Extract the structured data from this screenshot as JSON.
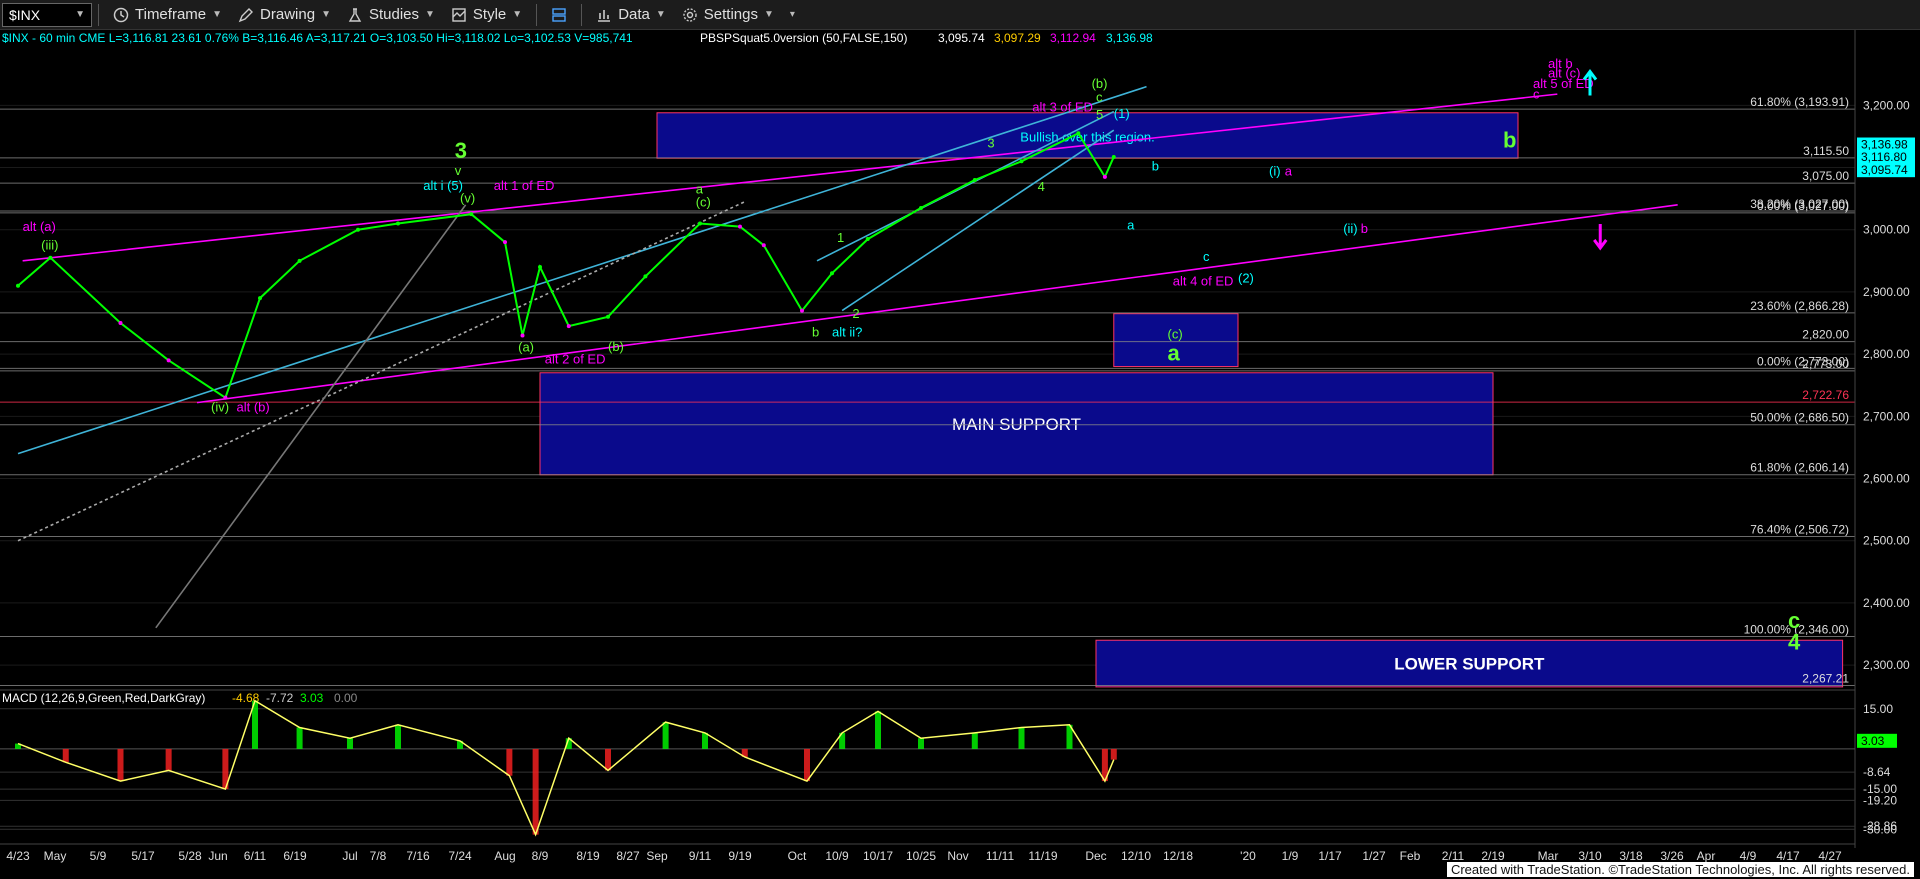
{
  "toolbar": {
    "symbol": "$INX",
    "timeframe": "Timeframe",
    "drawing": "Drawing",
    "studies": "Studies",
    "style": "Style",
    "data": "Data",
    "settings": "Settings"
  },
  "colors": {
    "price_up": "#00ff00",
    "price_down": "#ff00ff",
    "magenta": "#ff00ff",
    "cyan": "#00ffff",
    "green_label": "#66ff33",
    "box_fill": "#0a0a8c"
  },
  "chart_data": {
    "type": "line",
    "title": "$INX - 60 min  CME  L=3,116.81  23.61  0.76%  B=3,116.46  A=3,117.21  O=3,103.50  Hi=3,118.02  Lo=3,102.53  V=985,741",
    "indicator_header": "PBSPSquat5.0version (50,FALSE,150)",
    "indicator_values": [
      "3,095.74",
      "3,097.29",
      "3,112.94",
      "3,136.98"
    ],
    "ylim": [
      2260,
      3260
    ],
    "y_ticks": [
      3200,
      3100,
      3000,
      2900,
      2800,
      2700,
      2600,
      2500,
      2400,
      2300
    ],
    "y_tick_labels": [
      "3,200.00",
      "3,100.00",
      "3,000.00",
      "2,900.00",
      "2,800.00",
      "2,700.00",
      "2,600.00",
      "2,500.00",
      "2,400.00",
      "2,300.00"
    ],
    "x_labels": [
      "4/23",
      "May",
      "5/9",
      "5/17",
      "5/28",
      "Jun",
      "6/11",
      "6/19",
      "Jul",
      "7/8",
      "7/16",
      "7/24",
      "Aug",
      "8/9",
      "8/19",
      "8/27",
      "Sep",
      "9/11",
      "9/19",
      "Oct",
      "10/9",
      "10/17",
      "10/25",
      "Nov",
      "11/11",
      "11/19",
      "Dec",
      "12/10",
      "12/18",
      "'20",
      "1/9",
      "1/17",
      "1/27",
      "Feb",
      "2/11",
      "2/19",
      "Mar",
      "3/10",
      "3/18",
      "3/26",
      "Apr",
      "4/9",
      "4/17",
      "4/27"
    ],
    "price_series": {
      "name": "",
      "x": [
        "4/23",
        "4/30",
        "5/13",
        "5/23",
        "6/3",
        "6/12",
        "6/20",
        "7/3",
        "7/12",
        "7/26",
        "8/1",
        "8/5",
        "8/9",
        "8/15",
        "8/23",
        "8/30",
        "9/11",
        "9/19",
        "9/24",
        "10/2",
        "10/8",
        "10/15",
        "10/25",
        "11/5",
        "11/15",
        "11/27",
        "12/3",
        "12/5"
      ],
      "y": [
        2910,
        2955,
        2850,
        2790,
        2730,
        2890,
        2950,
        3000,
        3010,
        3025,
        2980,
        2830,
        2940,
        2845,
        2860,
        2925,
        3010,
        3005,
        2975,
        2870,
        2930,
        2985,
        3035,
        3080,
        3110,
        3155,
        3085,
        3117
      ]
    },
    "price_labels": [
      {
        "value": "3,136.98",
        "color": "#00ffff"
      },
      {
        "value": "3,116.80",
        "color": "#00ffff"
      },
      {
        "value": "3,095.74",
        "color": "#00ffff"
      }
    ],
    "fib_levels": [
      {
        "label": "61.80% (3,193.91)",
        "value": 3193.91
      },
      {
        "label": "3,115.50",
        "value": 3115.5
      },
      {
        "label": "3,075.00",
        "value": 3075.0
      },
      {
        "label": "38.20% (3,027.00)",
        "value": 3030.0
      },
      {
        "label": "0.00% (3,027.00)",
        "value": 3027.0
      },
      {
        "label": "23.60% (2,866.28)",
        "value": 2866.28
      },
      {
        "label": "2,820.00",
        "value": 2820.0
      },
      {
        "label": "0.00% (2,773.00)",
        "value": 2777.0
      },
      {
        "label": "2,773.00",
        "value": 2773.0
      },
      {
        "label": "2,722.76",
        "value": 2722.76
      },
      {
        "label": "50.00% (2,686.50)",
        "value": 2686.5
      },
      {
        "label": "61.80% (2,606.14)",
        "value": 2606.14
      },
      {
        "label": "76.40% (2,506.72)",
        "value": 2506.72
      },
      {
        "label": "100.00% (2,346.00)",
        "value": 2346.0
      },
      {
        "label": "2,267.21",
        "value": 2267.21
      }
    ],
    "zones": [
      {
        "label": "Bullish over this region.",
        "y1": 3115,
        "y2": 3188,
        "x1": "9/1",
        "x2": "2/24"
      },
      {
        "label": "MAIN SUPPORT",
        "y1": 2606,
        "y2": 2770,
        "x1": "8/9",
        "x2": "2/19"
      },
      {
        "label": "LOWER SUPPORT",
        "y1": 2265,
        "y2": 2340,
        "x1": "12/1",
        "x2": "4/30"
      },
      {
        "label": "",
        "y1": 2780,
        "y2": 2865,
        "x1": "12/5",
        "x2": "12/30"
      }
    ],
    "wave_labels": [
      {
        "text": "alt (a)",
        "x": "4/24",
        "y": 2998,
        "color": "#ff00ff"
      },
      {
        "text": "(iii)",
        "x": "4/28",
        "y": 2968,
        "color": "#66ff33"
      },
      {
        "text": "(iv)",
        "x": "5/31",
        "y": 2708,
        "color": "#66ff33"
      },
      {
        "text": "alt (b)",
        "x": "6/6",
        "y": 2708,
        "color": "#ff00ff"
      },
      {
        "text": "3",
        "x": "7/23",
        "y": 3115,
        "color": "#66ff33"
      },
      {
        "text": "v",
        "x": "7/23",
        "y": 3088,
        "color": "#66ff33"
      },
      {
        "text": "alt i (5)",
        "x": "7/17",
        "y": 3064,
        "color": "#00ffff"
      },
      {
        "text": "(v)",
        "x": "7/24",
        "y": 3044,
        "color": "#66ff33"
      },
      {
        "text": "alt 1 of ED",
        "x": "7/30",
        "y": 3064,
        "color": "#ff00ff"
      },
      {
        "text": "(a)",
        "x": "8/4",
        "y": 2804,
        "color": "#66ff33"
      },
      {
        "text": "alt 2 of ED",
        "x": "8/10",
        "y": 2785,
        "color": "#ff00ff"
      },
      {
        "text": "(b)",
        "x": "8/23",
        "y": 2805,
        "color": "#66ff33"
      },
      {
        "text": "a",
        "x": "9/10",
        "y": 3058,
        "color": "#66ff33"
      },
      {
        "text": "(c)",
        "x": "9/10",
        "y": 3037,
        "color": "#66ff33"
      },
      {
        "text": "b",
        "x": "10/4",
        "y": 2828,
        "color": "#66ff33"
      },
      {
        "text": "alt ii?",
        "x": "10/8",
        "y": 2828,
        "color": "#00ffff"
      },
      {
        "text": "1",
        "x": "10/9",
        "y": 2980,
        "color": "#66ff33"
      },
      {
        "text": "2",
        "x": "10/12",
        "y": 2858,
        "color": "#66ff33"
      },
      {
        "text": "3",
        "x": "11/8",
        "y": 3132,
        "color": "#66ff33"
      },
      {
        "text": "4",
        "x": "11/18",
        "y": 3062,
        "color": "#66ff33"
      },
      {
        "text": "alt 3 of ED",
        "x": "11/17",
        "y": 3190,
        "color": "#ff00ff"
      },
      {
        "text": "(b)",
        "x": "11/30",
        "y": 3228,
        "color": "#66ff33"
      },
      {
        "text": "c",
        "x": "12/1",
        "y": 3206,
        "color": "#66ff33"
      },
      {
        "text": "5",
        "x": "12/1",
        "y": 3178,
        "color": "#66ff33"
      },
      {
        "text": "(1)",
        "x": "12/5",
        "y": 3180,
        "color": "#00ffff"
      },
      {
        "text": "b",
        "x": "12/13",
        "y": 3095,
        "color": "#00ffff"
      },
      {
        "text": "a",
        "x": "12/8",
        "y": 3000,
        "color": "#00ffff"
      },
      {
        "text": "c",
        "x": "12/23",
        "y": 2950,
        "color": "#00ffff"
      },
      {
        "text": "alt 4 of ED",
        "x": "12/17",
        "y": 2910,
        "color": "#ff00ff"
      },
      {
        "text": "(2)",
        "x": "12/30",
        "y": 2915,
        "color": "#00ffff"
      },
      {
        "text": "(i)",
        "x": "1/5",
        "y": 3087,
        "color": "#00ffff"
      },
      {
        "text": "a",
        "x": "1/8",
        "y": 3087,
        "color": "#ff00ff"
      },
      {
        "text": "(ii)",
        "x": "1/20",
        "y": 2995,
        "color": "#00ffff"
      },
      {
        "text": "b",
        "x": "1/24",
        "y": 2995,
        "color": "#ff00ff"
      },
      {
        "text": "(c)",
        "x": "12/16",
        "y": 2825,
        "color": "#66ff33"
      },
      {
        "text": "a",
        "x": "12/16",
        "y": 2790,
        "color": "#66ff33"
      },
      {
        "text": "b",
        "x": "2/21",
        "y": 3132,
        "color": "#66ff33"
      },
      {
        "text": "alt b",
        "x": "3/1",
        "y": 3260,
        "color": "#ff00ff"
      },
      {
        "text": "alt (c)",
        "x": "3/1",
        "y": 3245,
        "color": "#ff00ff"
      },
      {
        "text": "alt 5 of ED",
        "x": "2/27",
        "y": 3228,
        "color": "#ff00ff"
      },
      {
        "text": "c",
        "x": "2/27",
        "y": 3211,
        "color": "#ff00ff"
      },
      {
        "text": "c",
        "x": "4/17",
        "y": 2360,
        "color": "#66ff33"
      },
      {
        "text": "4",
        "x": "4/17",
        "y": 2325,
        "color": "#66ff33"
      }
    ],
    "arrows": [
      {
        "x": "3/10",
        "y": 3235,
        "direction": "up",
        "color": "#00ffff"
      },
      {
        "x": "3/12",
        "y": 2990,
        "direction": "down",
        "color": "#ff00ff"
      }
    ],
    "macd": {
      "title": "MACD (12,26,9,Green,Red,DarkGray)",
      "values": [
        "-4.68",
        "-7.72",
        "3.03",
        "0.00"
      ],
      "ylim": [
        -34,
        22
      ],
      "y_ticks": [
        15,
        -8.64,
        -15,
        -19.2,
        -28.86,
        -30
      ],
      "y_tick_labels": [
        "15.00",
        "-8.64",
        "-15.00",
        "-19.20",
        "-28.86",
        "-30.00"
      ],
      "current_label": "3.03",
      "series_x": [
        "4/23",
        "5/3",
        "5/13",
        "5/23",
        "6/3",
        "6/11",
        "6/20",
        "7/1",
        "7/12",
        "7/24",
        "8/2",
        "8/8",
        "8/15",
        "8/23",
        "9/3",
        "9/12",
        "9/20",
        "10/3",
        "10/10",
        "10/17",
        "10/25",
        "11/5",
        "11/15",
        "11/25",
        "12/3",
        "12/5"
      ],
      "series_y": [
        2,
        -5,
        -12,
        -8,
        -15,
        18,
        8,
        4,
        9,
        3,
        -10,
        -32,
        4,
        -8,
        10,
        6,
        -3,
        -12,
        6,
        14,
        4,
        6,
        8,
        9,
        -12,
        -4
      ]
    },
    "credit": "Created with TradeStation. ©TradeStation Technologies, Inc. All rights reserved."
  }
}
